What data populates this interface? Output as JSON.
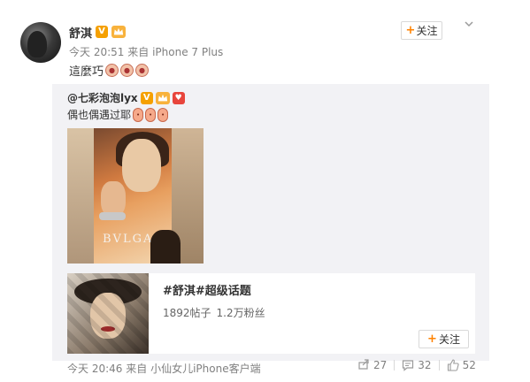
{
  "author": {
    "name": "舒淇",
    "verified_badge": "V",
    "vip_badge": "VIP"
  },
  "post": {
    "time": "今天 20:51",
    "source_prefix": "来自",
    "source": "iPhone 7 Plus",
    "text": "這麼巧",
    "emoji_count_display": "3"
  },
  "follow": {
    "label": "关注",
    "plus": "+"
  },
  "repost": {
    "user": "@七彩泡泡lyx",
    "verified_badge": "V",
    "text": "偶也偶遇过耶",
    "photo_brand": "BVLGARI"
  },
  "topic": {
    "title": "#舒淇#超级话题",
    "posts": "1892帖子",
    "fans": "1.2万粉丝",
    "follow_label": "关注",
    "follow_plus": "+"
  },
  "repost_meta": {
    "time": "今天 20:46",
    "source_prefix": "来自",
    "source": "小仙女儿iPhone客户端"
  },
  "actions": {
    "reposts": "27",
    "comments": "32",
    "likes": "52"
  },
  "icons": {
    "caret": "chevron-down-icon",
    "repost": "repost-icon",
    "comment": "comment-icon",
    "like": "like-icon"
  },
  "colors": {
    "accent": "#ff8200",
    "meta": "#808080",
    "repost_bg": "#f2f2f5"
  }
}
